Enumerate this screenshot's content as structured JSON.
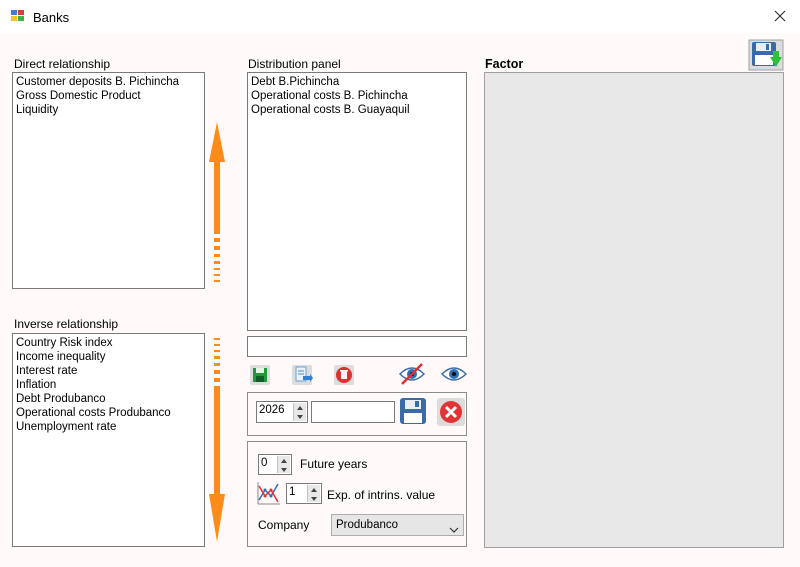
{
  "window": {
    "title": "Banks"
  },
  "labels": {
    "direct": "Direct relationship",
    "inverse": "Inverse relationship",
    "distribution": "Distribution panel",
    "factor": "Factor"
  },
  "direct_items": [
    "Customer deposits B. Pichincha",
    "Gross Domestic Product",
    "Liquidity"
  ],
  "distribution_items": [
    "Debt B.Pichincha",
    "Operational costs B. Pichincha",
    "Operational costs B. Guayaquil"
  ],
  "inverse_items": [
    "Country Risk index",
    "Income inequality",
    "Interest rate",
    "Inflation",
    "Debt Produbanco",
    "Operational costs Produbanco",
    "Unemployment rate"
  ],
  "year_spinner": {
    "value": "2026"
  },
  "future_years": {
    "value": "0",
    "label": "Future years"
  },
  "exp_intrins": {
    "value": "1",
    "label": "Exp. of intrins. value"
  },
  "company": {
    "label": "Company",
    "selected": "Produbanco"
  },
  "colors": {
    "arrow": "#ff8c1a",
    "window_bg": "#fffaf9",
    "factor_bg": "#e8e8e8"
  },
  "icons": [
    "app-icon",
    "close-icon",
    "save-disk-icon",
    "save-icon",
    "export-icon",
    "delete-icon",
    "eye-hidden-icon",
    "eye-icon",
    "floppy-icon",
    "cancel-icon",
    "chart-icon",
    "arrow-up-icon",
    "arrow-down-icon",
    "chevron-down-icon"
  ]
}
